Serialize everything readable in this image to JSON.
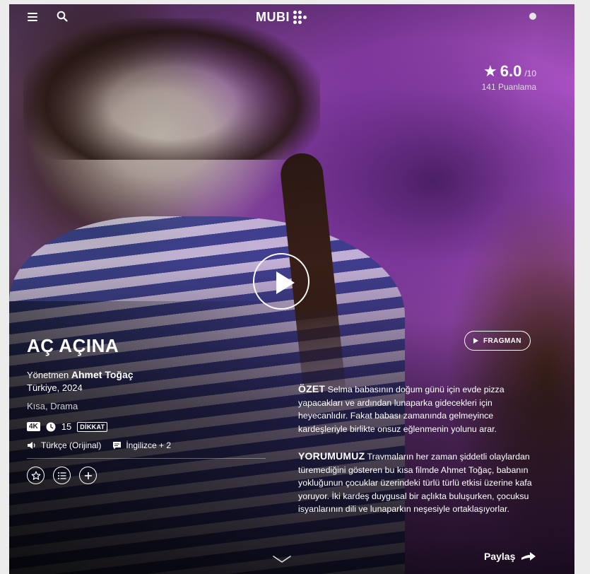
{
  "header": {
    "logo_text": "MUBI"
  },
  "rating": {
    "value": "6.0",
    "scale": "/10",
    "count_text": "141 Puanlama"
  },
  "film": {
    "title": "AÇ AÇINA",
    "director_label": "Yönetmen",
    "director_name": "Ahmet Toğaç",
    "country_year": "Türkiye, 2024",
    "genres": "Kısa, Drama",
    "resolution_badge": "4K",
    "age_rating": "15",
    "warning_badge": "DİKKAT",
    "audio_language": "Türkçe (Orijinal)",
    "subtitle_languages": "İngilizce + 2"
  },
  "trailer": {
    "label": "FRAGMAN"
  },
  "synopsis": {
    "label": "ÖZET",
    "text": "Selma babasının doğum günü için evde pizza yapacakları ve ardından lunaparka gidecekleri için heyecanlıdır. Fakat babası zamanında gelmeyince kardeşleriyle birlikte onsuz eğlenmenin yolunu arar."
  },
  "review": {
    "label": "YORUMUMUZ",
    "text": "Travmaların her zaman şiddetli olaylardan türemediğini gösteren bu kısa filmde Ahmet Toğaç, babanın yokluğunun çocuklar üzerindeki türlü türlü etkisi üzerine kafa yoruyor. İki kardeş duygusal bir açlıkta buluşurken, çocuksu isyanlarının dili ve lunaparkın neşesiyle ortaklaşıyorlar."
  },
  "share": {
    "label": "Paylaş"
  },
  "icons": {
    "menu": "menu-icon",
    "search": "search-icon",
    "star": "star-icon",
    "play": "play-icon",
    "clock": "clock-icon",
    "speaker": "speaker-icon",
    "subtitles": "subtitles-icon",
    "rate": "star-outline-icon",
    "watchlist_list": "list-icon",
    "add": "plus-icon",
    "share": "arrow-right-icon",
    "scroll": "chevron-down-icon"
  },
  "colors": {
    "accent_background": "#8f3fb0",
    "text": "#ffffff"
  }
}
